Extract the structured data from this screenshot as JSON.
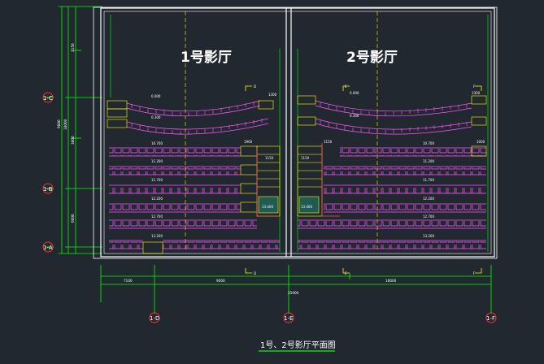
{
  "drawing": {
    "title": "1号、2号影厅平面图",
    "hall1_label": "1号影厅",
    "hall2_label": "2号影厅"
  },
  "grid_axes": {
    "left": [
      "1-C",
      "1-B",
      "1-A"
    ],
    "bottom": [
      "1-D",
      "1-E",
      "1-F"
    ]
  },
  "colors": {
    "background": "#212830",
    "walls": "#ffffff",
    "dimension_lines": "#00ff00",
    "seats": "#ff55ff",
    "steps": "#ffff00",
    "axis_circles": "#ff3030"
  }
}
